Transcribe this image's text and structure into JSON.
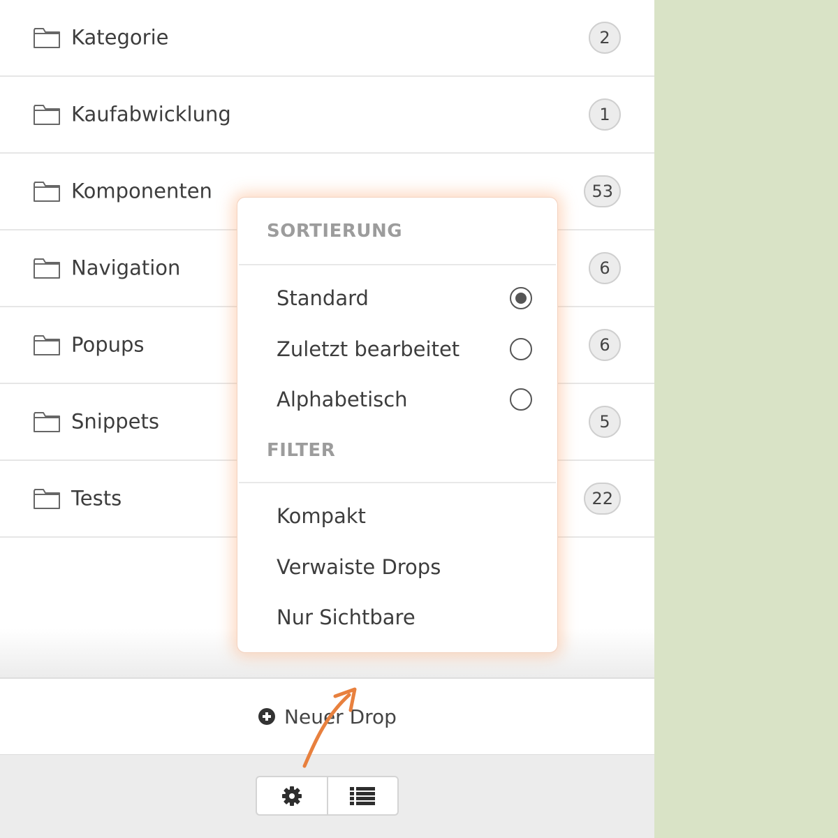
{
  "folders": [
    {
      "label": "Kategorie",
      "count": "2"
    },
    {
      "label": "Kaufabwicklung",
      "count": "1"
    },
    {
      "label": "Komponenten",
      "count": "53"
    },
    {
      "label": "Navigation",
      "count": "6"
    },
    {
      "label": "Popups",
      "count": "6"
    },
    {
      "label": "Snippets",
      "count": "5"
    },
    {
      "label": "Tests",
      "count": "22"
    }
  ],
  "new_drop": {
    "label": "Neuer Drop",
    "icon": "plus-circle-icon"
  },
  "toolbar": {
    "buttons": [
      {
        "icon": "gear-icon"
      },
      {
        "icon": "list-icon"
      }
    ]
  },
  "menu": {
    "sort_header": "SORTIERUNG",
    "sort_options": [
      {
        "label": "Standard",
        "selected": true
      },
      {
        "label": "Zuletzt bearbeitet",
        "selected": false
      },
      {
        "label": "Alphabetisch",
        "selected": false
      }
    ],
    "filter_header": "FILTER",
    "filter_options": [
      {
        "label": "Kompakt"
      },
      {
        "label": "Verwaiste Drops"
      },
      {
        "label": "Nur Sichtbare"
      }
    ]
  },
  "colors": {
    "background": "#d9e3c6",
    "accent_arrow": "#e8803e",
    "menu_glow": "#faaa78"
  }
}
